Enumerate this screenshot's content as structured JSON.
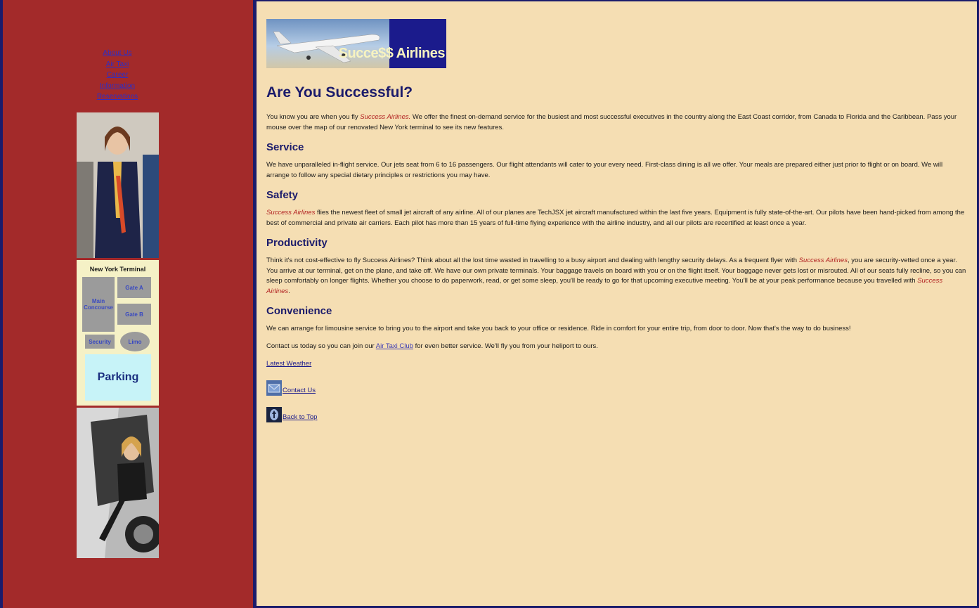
{
  "sidebar": {
    "nav": [
      "About Us",
      "Air Taxi",
      "Career",
      "Information",
      "Reservations"
    ],
    "terminal_map": {
      "title": "New York Terminal",
      "main": "Main Concourse",
      "gate_a": "Gate A",
      "gate_b": "Gate B",
      "security": "Security",
      "limo": "Limo",
      "parking": "Parking"
    }
  },
  "logo": {
    "text": "Succe$$ Airlines"
  },
  "main": {
    "title": "Are You Successful?",
    "intro": {
      "pre": "You know you are when you fly ",
      "brand": "Success Airlines.",
      "post": " We offer the finest on-demand service for the busiest and most successful executives in the country along the East Coast corridor, from Canada to Florida and the Caribbean. Pass your mouse over the map of our renovated New York terminal to see its new features."
    },
    "service": {
      "heading": "Service",
      "text": "We have unparalleled in-flight service. Our jets seat from 6 to 16 passengers. Our flight attendants will cater to your every need. First-class dining is all we offer. Your meals are prepared either just prior to flight or on board. We will arrange to follow any special dietary principles or restrictions you may have."
    },
    "safety": {
      "heading": "Safety",
      "brand": "Success Airlines",
      "text": " flies the newest fleet of small jet aircraft of any airline. All of our planes are TechJSX jet aircraft manufactured within the last five years. Equipment is fully state-of-the-art. Our pilots have been hand-picked from among the best of commercial and private air carriers. Each pilot has more than 15 years of full-time flying experience with the airline industry, and all our pilots are recertified at least once a year."
    },
    "productivity": {
      "heading": "Productivity",
      "pre": "Think it's not cost-effective to fly Success Airlines? Think about all the lost time wasted in travelling to a busy airport and dealing with lengthy security delays. As a frequent flyer with ",
      "brand1": "Success Airlines",
      "mid": ", you are security-vetted once a year. You arrive at our terminal, get on the plane, and take off. We have our own private terminals. Your baggage travels on board with you or on the flight itself. Your baggage never gets lost or misrouted. All of our seats fully recline, so you can sleep comfortably on longer flights. Whether you choose to do paperwork, read, or get some sleep, you'll be ready to go for that upcoming executive meeting. You'll be at your peak performance because you travelled with ",
      "brand2": "Success Airlines",
      "post": "."
    },
    "convenience": {
      "heading": "Convenience",
      "text": "We can arrange for limousine service to bring you to the airport and take you back to your office or residence. Ride in comfort for your entire trip, from door to door. Now that's the way to do business!"
    },
    "contact": {
      "pre": "Contact us today so you can join our ",
      "link": "Air Taxi Club",
      "post": " for even better service. We'll fly you from your heliport to ours."
    },
    "weather_link": "Latest Weather",
    "contact_link": "Contact Us",
    "top_link": "Back to Top"
  }
}
